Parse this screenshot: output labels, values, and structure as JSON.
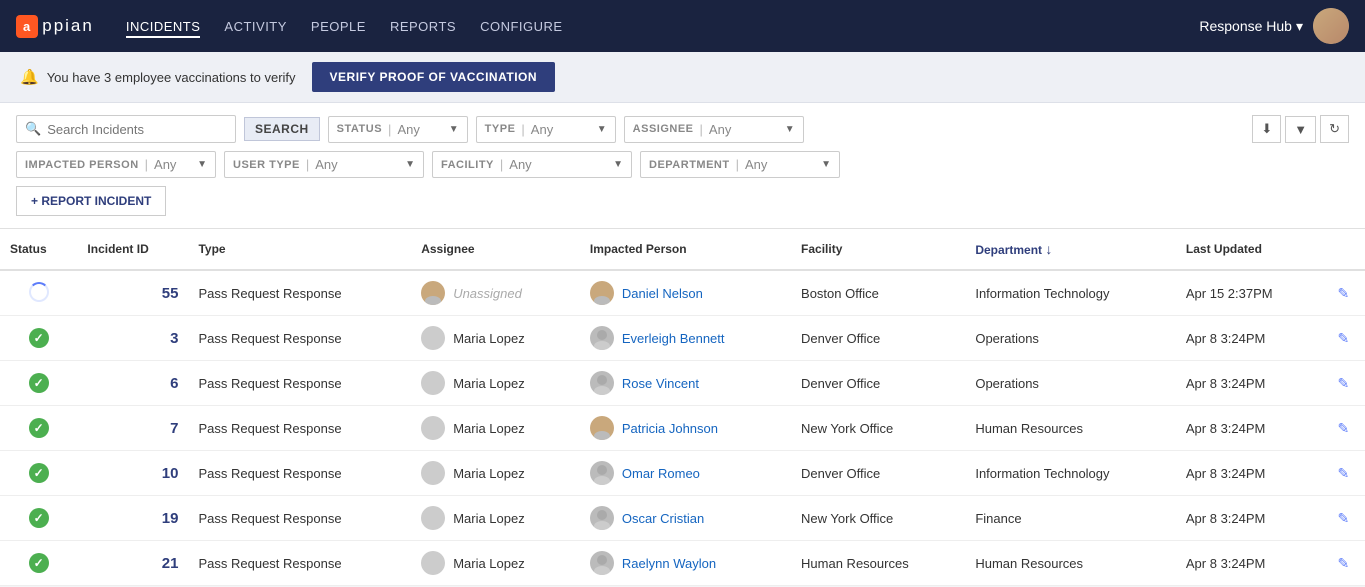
{
  "app": {
    "logo_accent": "appian",
    "logo_full": "appian"
  },
  "topnav": {
    "links": [
      {
        "id": "incidents",
        "label": "INCIDENTS",
        "active": true
      },
      {
        "id": "activity",
        "label": "ACTIVITY",
        "active": false
      },
      {
        "id": "people",
        "label": "PEOPLE",
        "active": false
      },
      {
        "id": "reports",
        "label": "REPORTS",
        "active": false
      },
      {
        "id": "configure",
        "label": "CONFIGURE",
        "active": false
      }
    ],
    "right_label": "Response Hub",
    "dropdown_icon": "▾"
  },
  "notification": {
    "message": "You have 3 employee vaccinations to verify",
    "button_label": "VERIFY PROOF OF VACCINATION"
  },
  "filters": {
    "search_placeholder": "Search Incidents",
    "search_button": "SEARCH",
    "status_label": "STATUS",
    "status_value": "Any",
    "type_label": "TYPE",
    "type_value": "Any",
    "assignee_label": "ASSIGNEE",
    "assignee_value": "Any",
    "impacted_label": "IMPACTED PERSON",
    "impacted_value": "Any",
    "usertype_label": "USER TYPE",
    "usertype_value": "Any",
    "facility_label": "FACILITY",
    "facility_value": "Any",
    "department_label": "DEPARTMENT",
    "department_value": "Any"
  },
  "report_button": "+ REPORT INCIDENT",
  "table": {
    "columns": [
      {
        "id": "status",
        "label": "Status",
        "sortable": false
      },
      {
        "id": "incident_id",
        "label": "Incident ID",
        "sortable": false
      },
      {
        "id": "type",
        "label": "Type",
        "sortable": false
      },
      {
        "id": "assignee",
        "label": "Assignee",
        "sortable": false
      },
      {
        "id": "impacted_person",
        "label": "Impacted Person",
        "sortable": false
      },
      {
        "id": "facility",
        "label": "Facility",
        "sortable": false
      },
      {
        "id": "department",
        "label": "Department",
        "sortable": true
      },
      {
        "id": "last_updated",
        "label": "Last Updated",
        "sortable": false
      }
    ],
    "rows": [
      {
        "status": "spinner",
        "incident_id": "55",
        "type": "Pass Request Response",
        "assignee": "Unassigned",
        "assignee_avatar": "photo",
        "impacted_person": "Daniel Nelson",
        "impacted_avatar": "photo",
        "facility": "Boston Office",
        "department": "Information Technology",
        "last_updated": "Apr 15 2:37PM"
      },
      {
        "status": "check",
        "incident_id": "3",
        "type": "Pass Request Response",
        "assignee": "Maria Lopez",
        "assignee_avatar": "generic",
        "impacted_person": "Everleigh Bennett",
        "impacted_avatar": "generic",
        "facility": "Denver Office",
        "department": "Operations",
        "last_updated": "Apr 8 3:24PM"
      },
      {
        "status": "check",
        "incident_id": "6",
        "type": "Pass Request Response",
        "assignee": "Maria Lopez",
        "assignee_avatar": "generic",
        "impacted_person": "Rose Vincent",
        "impacted_avatar": "generic",
        "facility": "Denver Office",
        "department": "Operations",
        "last_updated": "Apr 8 3:24PM"
      },
      {
        "status": "check",
        "incident_id": "7",
        "type": "Pass Request Response",
        "assignee": "Maria Lopez",
        "assignee_avatar": "generic",
        "impacted_person": "Patricia Johnson",
        "impacted_avatar": "photo",
        "facility": "New York Office",
        "department": "Human Resources",
        "last_updated": "Apr 8 3:24PM"
      },
      {
        "status": "check",
        "incident_id": "10",
        "type": "Pass Request Response",
        "assignee": "Maria Lopez",
        "assignee_avatar": "generic",
        "impacted_person": "Omar Romeo",
        "impacted_avatar": "generic",
        "facility": "Denver Office",
        "department": "Information Technology",
        "last_updated": "Apr 8 3:24PM"
      },
      {
        "status": "check",
        "incident_id": "19",
        "type": "Pass Request Response",
        "assignee": "Maria Lopez",
        "assignee_avatar": "generic",
        "impacted_person": "Oscar Cristian",
        "impacted_avatar": "generic",
        "facility": "New York Office",
        "department": "Finance",
        "last_updated": "Apr 8 3:24PM"
      },
      {
        "status": "check",
        "incident_id": "21",
        "type": "Pass Request Response",
        "assignee": "Maria Lopez",
        "assignee_avatar": "generic",
        "impacted_person": "Raelynn Waylon",
        "impacted_avatar": "generic",
        "facility": "Human Resources",
        "department": "Human Resources",
        "last_updated": "Apr 8 3:24PM"
      }
    ]
  }
}
